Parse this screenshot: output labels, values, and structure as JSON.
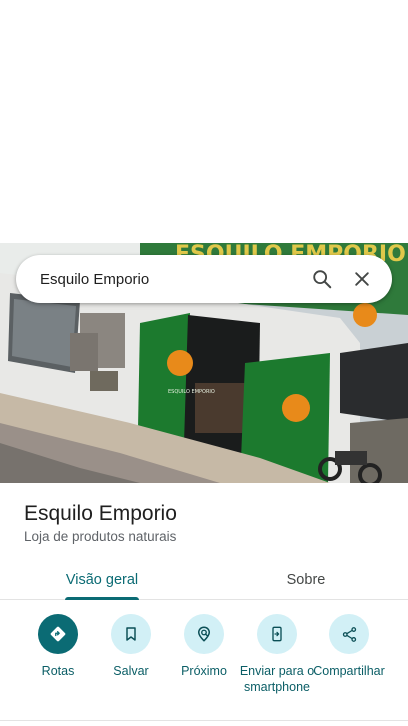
{
  "search": {
    "query": "Esquilo Emporio"
  },
  "photo": {
    "sign_text": "ESQUILO EMPORIO",
    "door_sign_text": "ESQUILO EMPORIO"
  },
  "place": {
    "title": "Esquilo Emporio",
    "category": "Loja de produtos naturais"
  },
  "tabs": [
    {
      "label": "Visão geral",
      "active": true
    },
    {
      "label": "Sobre",
      "active": false
    }
  ],
  "actions": [
    {
      "label": "Rotas",
      "icon": "directions-icon"
    },
    {
      "label": "Salvar",
      "icon": "bookmark-icon"
    },
    {
      "label": "Próximo",
      "icon": "nearby-icon"
    },
    {
      "label": "Enviar para o smartphone",
      "icon": "send-to-phone-icon"
    },
    {
      "label": "Compartilhar",
      "icon": "share-icon"
    }
  ],
  "colors": {
    "accent": "#0b6b74",
    "action_bg": "#d2f0f6",
    "store_green": "#1c7a2e"
  }
}
